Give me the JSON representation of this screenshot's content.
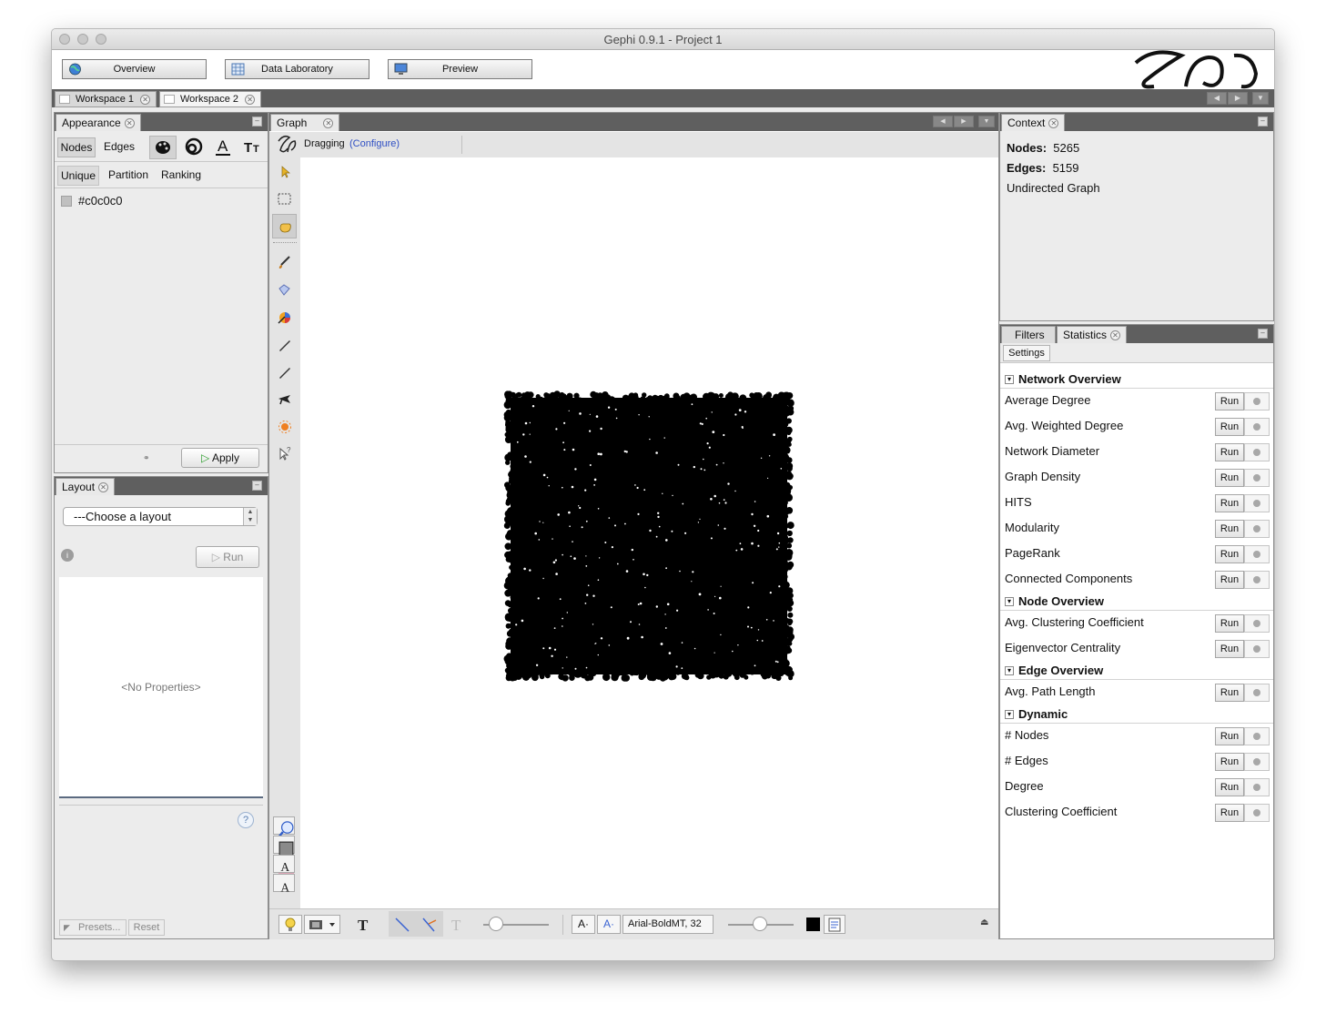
{
  "window": {
    "title": "Gephi 0.9.1 - Project 1"
  },
  "modes": {
    "overview": "Overview",
    "data_lab": "Data Laboratory",
    "preview": "Preview"
  },
  "workspaces": [
    "Workspace 1",
    "Workspace 2"
  ],
  "appearance": {
    "tab": "Appearance",
    "target_tabs": [
      "Nodes",
      "Edges"
    ],
    "mode_tabs": [
      "Unique",
      "Partition",
      "Ranking"
    ],
    "color_value": "#c0c0c0",
    "apply_label": "Apply"
  },
  "layout_panel": {
    "tab": "Layout",
    "select_value": "---Choose a layout",
    "run_label": "Run",
    "no_props": "<No Properties>",
    "presets_label": "Presets...",
    "reset_label": "Reset"
  },
  "graph_panel": {
    "tab": "Graph",
    "tool_label": "Dragging",
    "configure_link": "(Configure)",
    "font_label": "Arial-BoldMT, 32",
    "node_color": "#000000"
  },
  "context": {
    "tab": "Context",
    "nodes_label": "Nodes:",
    "nodes_value": "5265",
    "edges_label": "Edges:",
    "edges_value": "5159",
    "graph_type": "Undirected Graph"
  },
  "statistics": {
    "tabs": [
      "Filters",
      "Statistics"
    ],
    "settings_label": "Settings",
    "run_label": "Run",
    "sections": [
      {
        "title": "Network Overview",
        "items": [
          "Average Degree",
          "Avg. Weighted Degree",
          "Network Diameter",
          "Graph Density",
          "HITS",
          "Modularity",
          "PageRank",
          "Connected Components"
        ]
      },
      {
        "title": "Node Overview",
        "items": [
          "Avg. Clustering Coefficient",
          "Eigenvector Centrality"
        ]
      },
      {
        "title": "Edge Overview",
        "items": [
          "Avg. Path Length"
        ]
      },
      {
        "title": "Dynamic",
        "items": [
          "# Nodes",
          "# Edges",
          "Degree",
          "Clustering Coefficient"
        ]
      }
    ]
  }
}
